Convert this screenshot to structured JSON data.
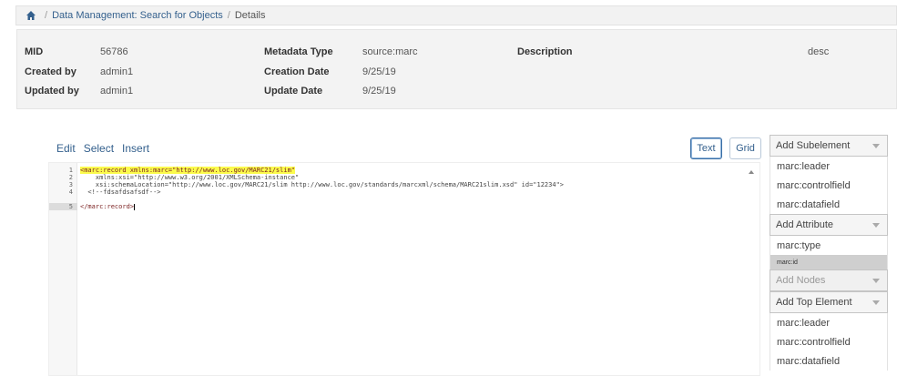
{
  "breadcrumb": {
    "home_icon": "home-icon",
    "items": [
      "Data Management: Search for Objects",
      "Details"
    ]
  },
  "details": {
    "mid_label": "MID",
    "mid_value": "56786",
    "created_by_label": "Created by",
    "created_by_value": "admin1",
    "updated_by_label": "Updated by",
    "updated_by_value": "admin1",
    "metadata_type_label": "Metadata Type",
    "metadata_type_value": "source:marc",
    "creation_date_label": "Creation Date",
    "creation_date_value": "9/25/19",
    "update_date_label": "Update Date",
    "update_date_value": "9/25/19",
    "description_label": "Description",
    "description_value": "desc"
  },
  "editor": {
    "menu": [
      "Edit",
      "Select",
      "Insert"
    ],
    "text_button": "Text",
    "grid_button": "Grid",
    "line_numbers": [
      "1",
      "2",
      "3",
      "4",
      "5"
    ],
    "lines": [
      "<marc:record xmlns:marc=\"http://www.loc.gov/MARC21/slim\"",
      "    xmlns:xsi=\"http://www.w3.org/2001/XMLSchema-instance\"",
      "    xsi:schemaLocation=\"http://www.loc.gov/MARC21/slim http://www.loc.gov/standards/marcxml/schema/MARC21slim.xsd\" id=\"12234\">",
      "  <!--fdsafdsafsdf-->",
      "</marc:record>"
    ]
  },
  "side_panel": {
    "add_subelement": "Add Subelement",
    "subelements": [
      "marc:leader",
      "marc:controlfield",
      "marc:datafield"
    ],
    "add_attribute": "Add Attribute",
    "attributes": [
      "marc:type",
      "marc:id"
    ],
    "add_nodes": "Add Nodes",
    "add_top_element": "Add Top Element",
    "top_elements": [
      "marc:leader",
      "marc:controlfield",
      "marc:datafield"
    ]
  }
}
